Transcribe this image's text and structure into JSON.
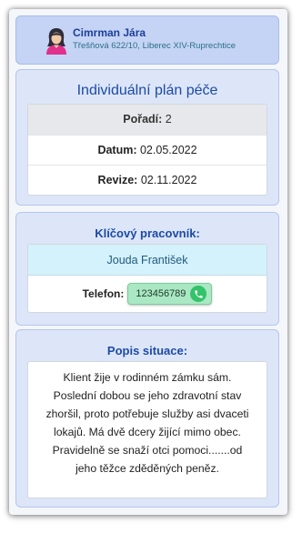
{
  "client": {
    "name": "Cimrman Jára",
    "address": "Třešňová 622/10, Liberec XIV-Ruprechtice"
  },
  "plan": {
    "title": "Individuální plán péče",
    "rows": [
      {
        "label": "Pořadí:",
        "value": "2"
      },
      {
        "label": "Datum:",
        "value": "02.05.2022"
      },
      {
        "label": "Revize:",
        "value": "02.11.2022"
      }
    ]
  },
  "worker": {
    "title": "Klíčový pracovník:",
    "name": "Jouda František",
    "phone_label": "Telefon:",
    "phone": "123456789",
    "phone_icon": "phone-call-icon"
  },
  "situation": {
    "title": "Popis situace:",
    "text": "Klient žije v rodinném zámku sám. Poslední dobou se jeho zdravotní stav zhoršil, proto potřebuje služby asi dvaceti lokajů. Má dvě dcery žijící mimo obec. Pravidelně se snaží otci pomoci.......od jeho těžce zděděných peněz."
  },
  "colors": {
    "accent_title": "#1d4aa6",
    "card_bg": "#dce6f8",
    "header_bg": "#c5d4f4",
    "worker_name_bg": "#d3f2fb",
    "phone_button_bg": "#a9e8c3",
    "phone_icon_bg": "#34c26b"
  }
}
